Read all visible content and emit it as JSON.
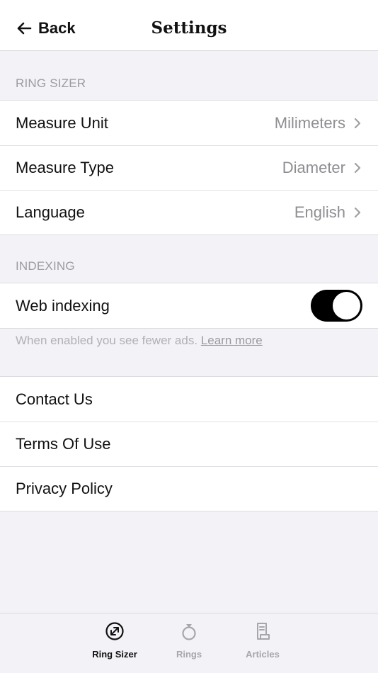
{
  "header": {
    "back_label": "Back",
    "title": "Settings"
  },
  "ring_sizer": {
    "section_label": "RING SIZER",
    "rows": [
      {
        "label": "Measure Unit",
        "value": "Milimeters"
      },
      {
        "label": "Measure Type",
        "value": "Diameter"
      },
      {
        "label": "Language",
        "value": "English"
      }
    ]
  },
  "indexing": {
    "section_label": "INDEXING",
    "web_indexing_label": "Web indexing",
    "web_indexing_enabled": true,
    "footnote_text": "When enabled you see fewer ads.",
    "learn_more_label": "Learn more"
  },
  "links": {
    "rows": [
      {
        "label": "Contact Us"
      },
      {
        "label": "Terms Of Use"
      },
      {
        "label": "Privacy Policy"
      }
    ]
  },
  "tabbar": {
    "tabs": [
      {
        "label": "Ring Sizer",
        "active": true
      },
      {
        "label": "Rings",
        "active": false
      },
      {
        "label": "Articles",
        "active": false
      }
    ]
  },
  "colors": {
    "background": "#f2f2f7",
    "toggle_on": "#000000",
    "secondary_text": "#8e8e93"
  }
}
